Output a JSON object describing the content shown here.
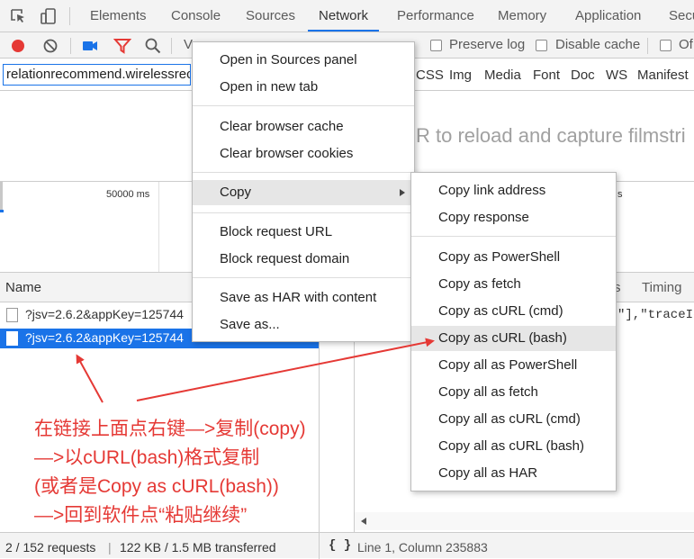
{
  "tabs": [
    {
      "label": "Elements"
    },
    {
      "label": "Console"
    },
    {
      "label": "Sources"
    },
    {
      "label": "Network",
      "active": true
    },
    {
      "label": "Performance"
    },
    {
      "label": "Memory"
    },
    {
      "label": "Application"
    },
    {
      "label": "Secu"
    }
  ],
  "toolbar": {
    "view_partial": "V",
    "preserve_log": "Preserve log",
    "disable_cache": "Disable cache",
    "offline_partial": "Of"
  },
  "filter": {
    "value": "relationrecommend.wirelessrec",
    "types": [
      "CSS",
      "Img",
      "Media",
      "Font",
      "Doc",
      "WS",
      "Manifest"
    ]
  },
  "filmstrip_message": "R to reload and capture filmstri",
  "overview": {
    "tick_1": "50000 ms",
    "tick_2": "s"
  },
  "table": {
    "name_header": "Name",
    "right_headers": [
      "s",
      "Timing"
    ],
    "rows": [
      {
        "name": "?jsv=2.6.2&appKey=125744"
      },
      {
        "name": "?jsv=2.6.2&appKey=125744",
        "selected": true
      }
    ],
    "response_snippet": "\"],\"traceId"
  },
  "status": {
    "requests": "2 / 152 requests",
    "divider": "|",
    "transferred": "122 KB / 1.5 MB transferred",
    "braces": "{ }",
    "position": "Line 1, Column 235883"
  },
  "context_menu": {
    "items": [
      "Open in Sources panel",
      "Open in new tab",
      "Clear browser cache",
      "Clear browser cookies",
      "Copy",
      "Block request URL",
      "Block request domain",
      "Save as HAR with content",
      "Save as..."
    ]
  },
  "copy_submenu": {
    "items": [
      "Copy link address",
      "Copy response",
      "Copy as PowerShell",
      "Copy as fetch",
      "Copy as cURL (cmd)",
      "Copy as cURL (bash)",
      "Copy all as PowerShell",
      "Copy all as fetch",
      "Copy all as cURL (cmd)",
      "Copy all as cURL (bash)",
      "Copy all as HAR"
    ],
    "highlighted": "Copy as cURL (bash)"
  },
  "annotation": {
    "lines": [
      "在链接上面点右键—>复制(copy)",
      "—>以cURL(bash)格式复制",
      "(或者是Copy as cURL(bash))",
      "—>回到软件点“粘贴继续”"
    ],
    "color": "#e53935"
  },
  "colors": {
    "accent": "#1a73e8",
    "record": "#e53935"
  }
}
